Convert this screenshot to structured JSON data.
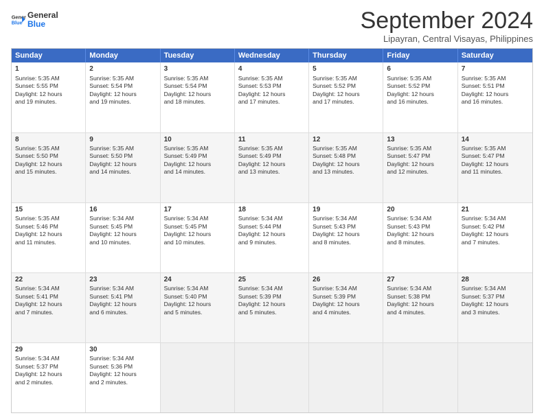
{
  "header": {
    "logo_line1": "General",
    "logo_line2": "Blue",
    "month_title": "September 2024",
    "subtitle": "Lipayran, Central Visayas, Philippines"
  },
  "weekdays": [
    "Sunday",
    "Monday",
    "Tuesday",
    "Wednesday",
    "Thursday",
    "Friday",
    "Saturday"
  ],
  "rows": [
    [
      {
        "day": "",
        "info": ""
      },
      {
        "day": "2",
        "info": "Sunrise: 5:35 AM\nSunset: 5:54 PM\nDaylight: 12 hours\nand 19 minutes."
      },
      {
        "day": "3",
        "info": "Sunrise: 5:35 AM\nSunset: 5:54 PM\nDaylight: 12 hours\nand 18 minutes."
      },
      {
        "day": "4",
        "info": "Sunrise: 5:35 AM\nSunset: 5:53 PM\nDaylight: 12 hours\nand 17 minutes."
      },
      {
        "day": "5",
        "info": "Sunrise: 5:35 AM\nSunset: 5:52 PM\nDaylight: 12 hours\nand 17 minutes."
      },
      {
        "day": "6",
        "info": "Sunrise: 5:35 AM\nSunset: 5:52 PM\nDaylight: 12 hours\nand 16 minutes."
      },
      {
        "day": "7",
        "info": "Sunrise: 5:35 AM\nSunset: 5:51 PM\nDaylight: 12 hours\nand 16 minutes."
      }
    ],
    [
      {
        "day": "1",
        "info": "Sunrise: 5:35 AM\nSunset: 5:55 PM\nDaylight: 12 hours\nand 19 minutes."
      },
      {
        "day": "9",
        "info": "Sunrise: 5:35 AM\nSunset: 5:50 PM\nDaylight: 12 hours\nand 14 minutes."
      },
      {
        "day": "10",
        "info": "Sunrise: 5:35 AM\nSunset: 5:49 PM\nDaylight: 12 hours\nand 14 minutes."
      },
      {
        "day": "11",
        "info": "Sunrise: 5:35 AM\nSunset: 5:49 PM\nDaylight: 12 hours\nand 13 minutes."
      },
      {
        "day": "12",
        "info": "Sunrise: 5:35 AM\nSunset: 5:48 PM\nDaylight: 12 hours\nand 13 minutes."
      },
      {
        "day": "13",
        "info": "Sunrise: 5:35 AM\nSunset: 5:47 PM\nDaylight: 12 hours\nand 12 minutes."
      },
      {
        "day": "14",
        "info": "Sunrise: 5:35 AM\nSunset: 5:47 PM\nDaylight: 12 hours\nand 11 minutes."
      }
    ],
    [
      {
        "day": "8",
        "info": "Sunrise: 5:35 AM\nSunset: 5:50 PM\nDaylight: 12 hours\nand 15 minutes."
      },
      {
        "day": "16",
        "info": "Sunrise: 5:34 AM\nSunset: 5:45 PM\nDaylight: 12 hours\nand 10 minutes."
      },
      {
        "day": "17",
        "info": "Sunrise: 5:34 AM\nSunset: 5:45 PM\nDaylight: 12 hours\nand 10 minutes."
      },
      {
        "day": "18",
        "info": "Sunrise: 5:34 AM\nSunset: 5:44 PM\nDaylight: 12 hours\nand 9 minutes."
      },
      {
        "day": "19",
        "info": "Sunrise: 5:34 AM\nSunset: 5:43 PM\nDaylight: 12 hours\nand 8 minutes."
      },
      {
        "day": "20",
        "info": "Sunrise: 5:34 AM\nSunset: 5:43 PM\nDaylight: 12 hours\nand 8 minutes."
      },
      {
        "day": "21",
        "info": "Sunrise: 5:34 AM\nSunset: 5:42 PM\nDaylight: 12 hours\nand 7 minutes."
      }
    ],
    [
      {
        "day": "15",
        "info": "Sunrise: 5:35 AM\nSunset: 5:46 PM\nDaylight: 12 hours\nand 11 minutes."
      },
      {
        "day": "23",
        "info": "Sunrise: 5:34 AM\nSunset: 5:41 PM\nDaylight: 12 hours\nand 6 minutes."
      },
      {
        "day": "24",
        "info": "Sunrise: 5:34 AM\nSunset: 5:40 PM\nDaylight: 12 hours\nand 5 minutes."
      },
      {
        "day": "25",
        "info": "Sunrise: 5:34 AM\nSunset: 5:39 PM\nDaylight: 12 hours\nand 5 minutes."
      },
      {
        "day": "26",
        "info": "Sunrise: 5:34 AM\nSunset: 5:39 PM\nDaylight: 12 hours\nand 4 minutes."
      },
      {
        "day": "27",
        "info": "Sunrise: 5:34 AM\nSunset: 5:38 PM\nDaylight: 12 hours\nand 4 minutes."
      },
      {
        "day": "28",
        "info": "Sunrise: 5:34 AM\nSunset: 5:37 PM\nDaylight: 12 hours\nand 3 minutes."
      }
    ],
    [
      {
        "day": "22",
        "info": "Sunrise: 5:34 AM\nSunset: 5:41 PM\nDaylight: 12 hours\nand 7 minutes."
      },
      {
        "day": "30",
        "info": "Sunrise: 5:34 AM\nSunset: 5:36 PM\nDaylight: 12 hours\nand 2 minutes."
      },
      {
        "day": "",
        "info": ""
      },
      {
        "day": "",
        "info": ""
      },
      {
        "day": "",
        "info": ""
      },
      {
        "day": "",
        "info": ""
      },
      {
        "day": "",
        "info": ""
      }
    ],
    [
      {
        "day": "29",
        "info": "Sunrise: 5:34 AM\nSunset: 5:37 PM\nDaylight: 12 hours\nand 2 minutes."
      },
      {
        "day": "",
        "info": ""
      },
      {
        "day": "",
        "info": ""
      },
      {
        "day": "",
        "info": ""
      },
      {
        "day": "",
        "info": ""
      },
      {
        "day": "",
        "info": ""
      },
      {
        "day": "",
        "info": ""
      }
    ]
  ]
}
